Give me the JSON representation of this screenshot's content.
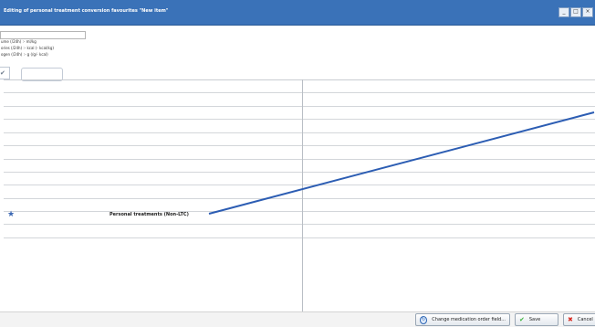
{
  "window": {
    "title": "Editing of personal treatment conversion favourites \"New item\"",
    "controls": {
      "minimize": "_",
      "maximize": "□",
      "close": "×"
    }
  },
  "form": {
    "name_value": "",
    "metrics": [
      "ume (/24h) :- ml/kg",
      "ories (/24h) :- kcal (- kcal/kg)",
      "ogen (/24h) :- g (/g/- kcal)"
    ],
    "check_mark": "✔",
    "small_value": ""
  },
  "table": {
    "row": {
      "star": "★",
      "label": "Personal treatments (Non-LTC)"
    }
  },
  "footer": {
    "change_field_label": "Change medication order field...",
    "save_label": "Save",
    "cancel_label": "Cancel"
  },
  "colors": {
    "titlebar": "#3a72b8",
    "arrow": "#2c5db3",
    "save_icon": "#3cb43c",
    "cancel_icon": "#d8281f"
  }
}
